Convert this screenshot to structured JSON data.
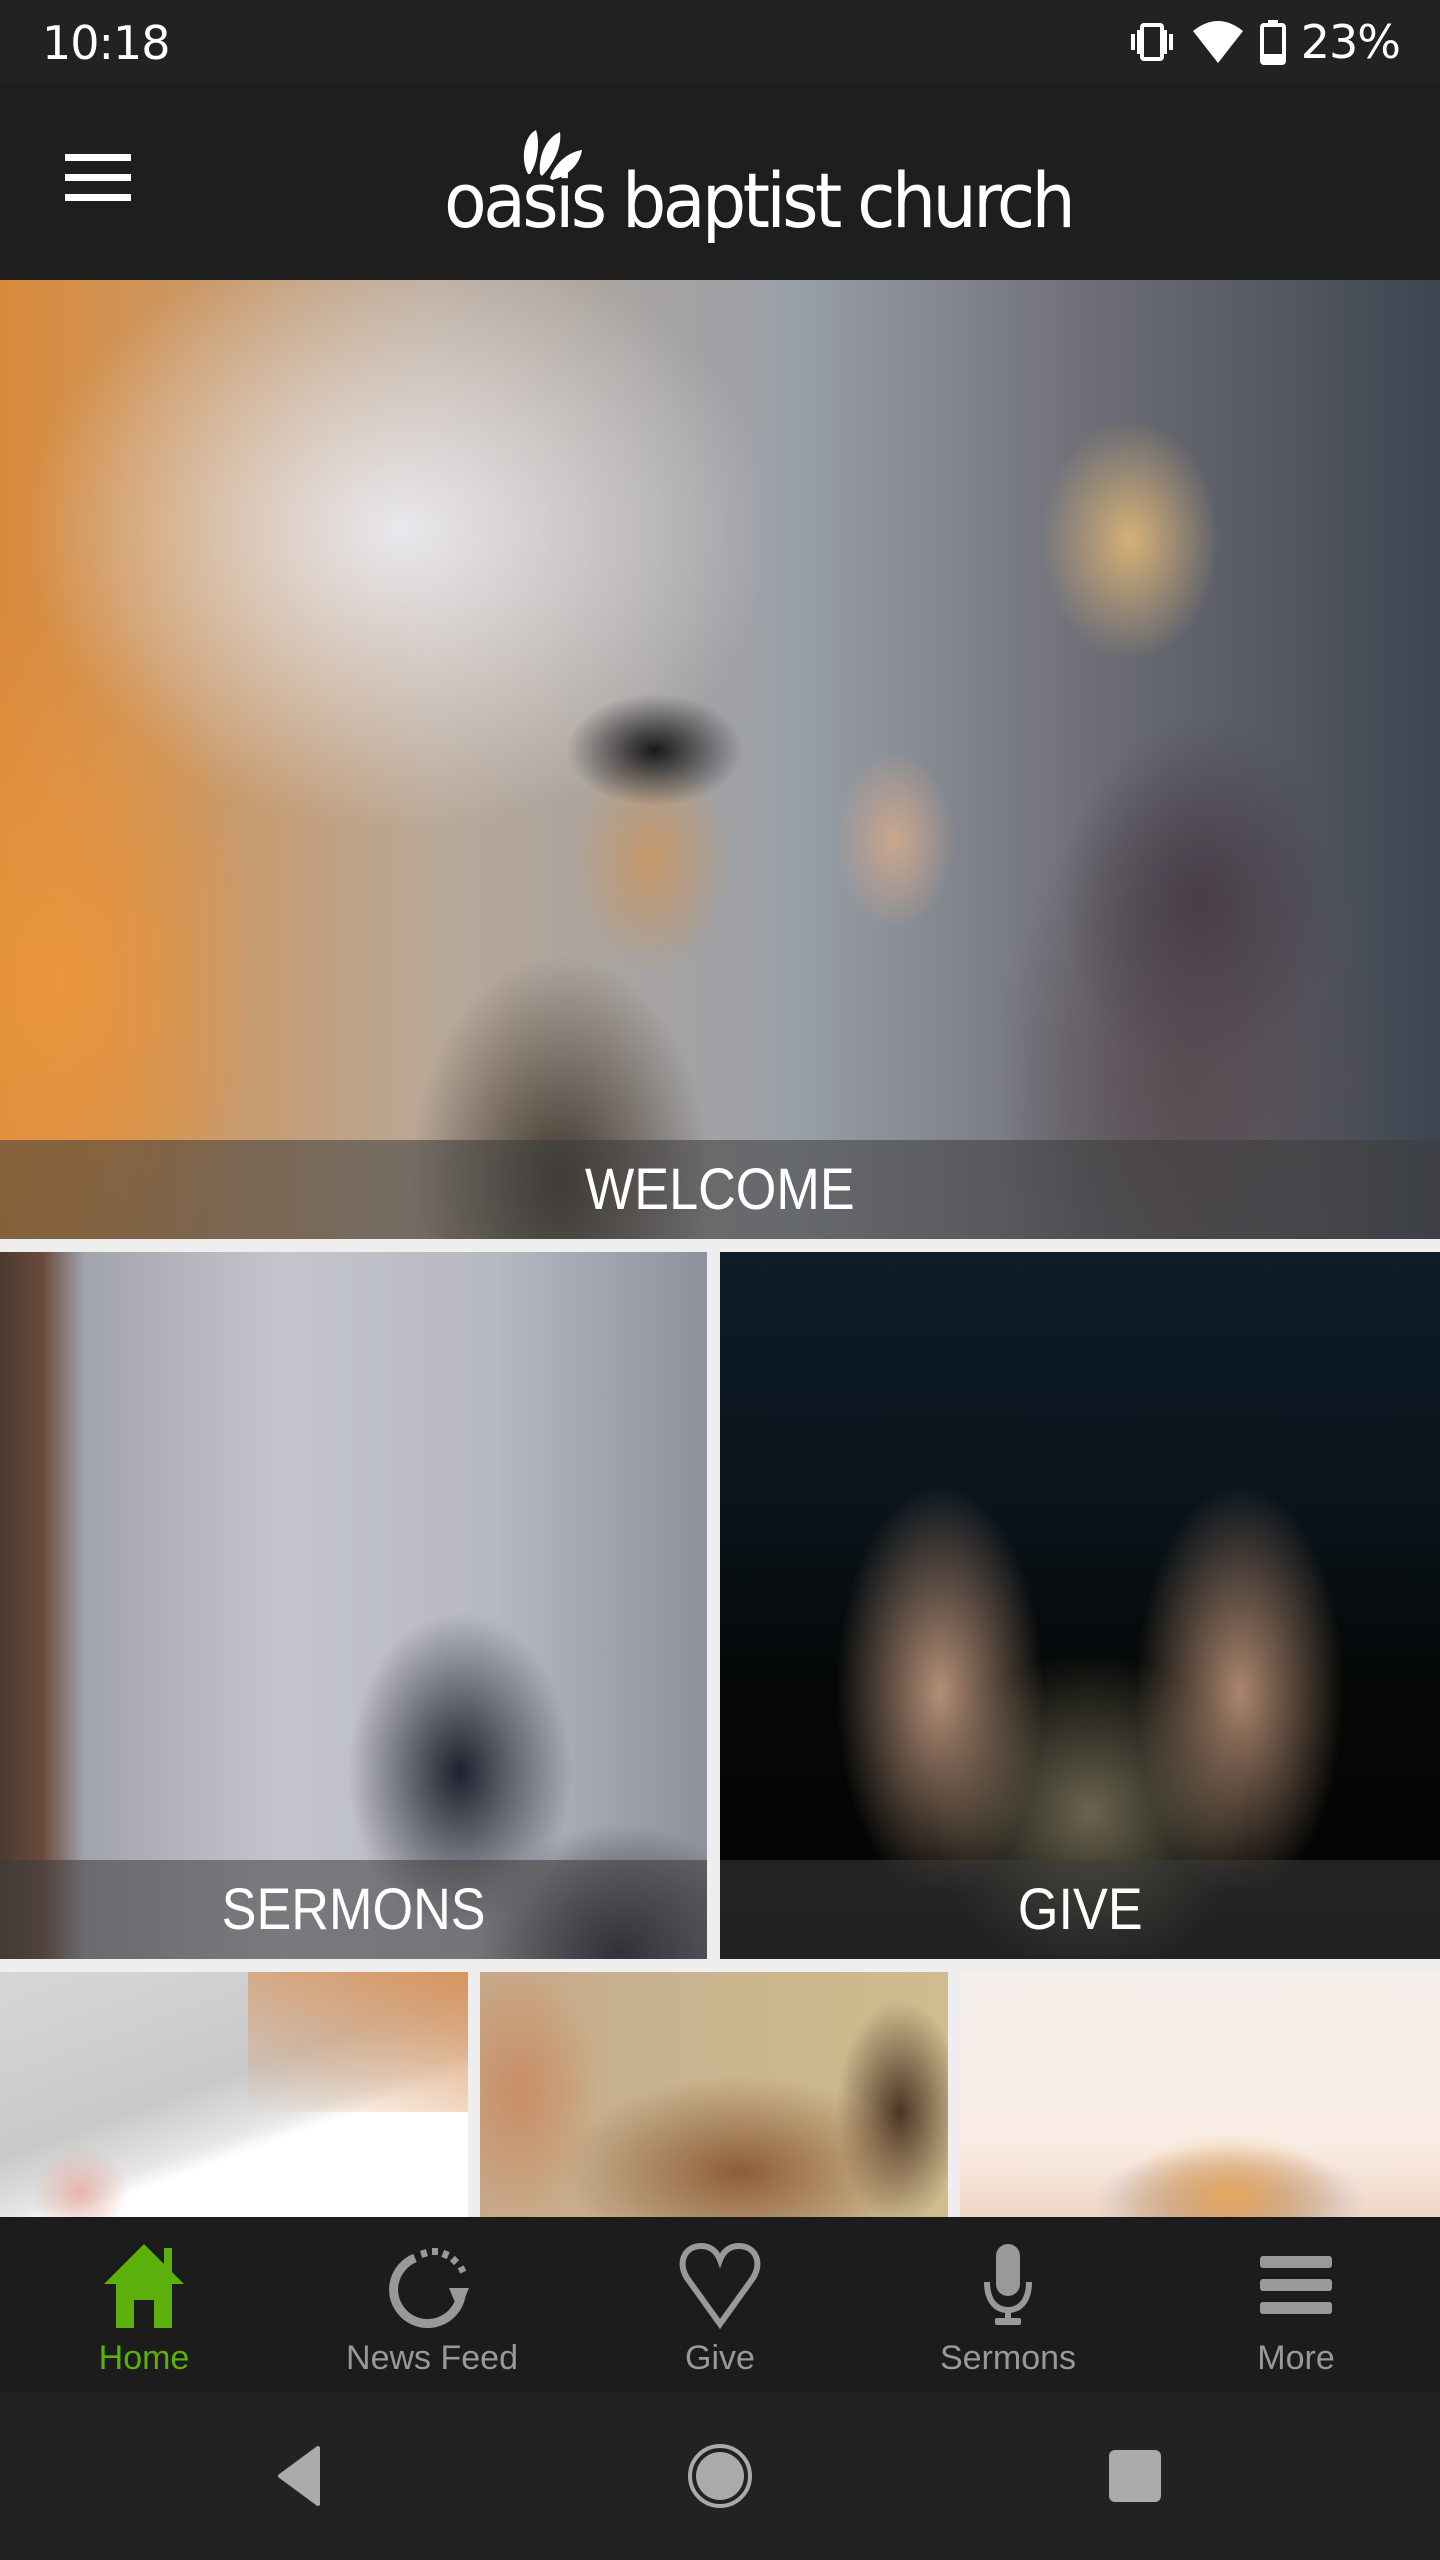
{
  "status_bar": {
    "time": "10:18",
    "battery_percent": "23%",
    "battery_level": 0.23,
    "icons": [
      "vibrate-icon",
      "wifi-icon",
      "battery-icon"
    ]
  },
  "header": {
    "menu_icon": "hamburger-menu-icon",
    "logo_text": "oasis baptist church",
    "logo_icon": "palm-leaves-icon"
  },
  "tiles": [
    {
      "label": "WELCOME"
    },
    {
      "label": "SERMONS"
    },
    {
      "label": "GIVE"
    },
    {
      "label": ""
    },
    {
      "label": ""
    },
    {
      "label": ""
    }
  ],
  "tab_bar": {
    "active_color": "#5cb00c",
    "inactive_color": "#999999",
    "tabs": [
      {
        "label": "Home",
        "icon": "home-icon",
        "active": true
      },
      {
        "label": "News Feed",
        "icon": "refresh-feed-icon",
        "active": false
      },
      {
        "label": "Give",
        "icon": "heart-icon",
        "active": false
      },
      {
        "label": "Sermons",
        "icon": "microphone-icon",
        "active": false
      },
      {
        "label": "More",
        "icon": "menu-icon",
        "active": false
      }
    ]
  },
  "system_nav": {
    "buttons": [
      "back-icon",
      "home-circle-icon",
      "recents-icon"
    ]
  }
}
